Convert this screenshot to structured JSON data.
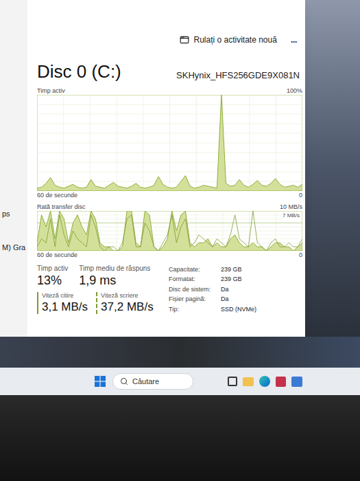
{
  "sidebar": {
    "items": [
      {
        "label": "ps"
      },
      {
        "label": "M) Gra"
      }
    ]
  },
  "toolbar": {
    "run_task": "Rulați o activitate nouă",
    "more": "..."
  },
  "disk": {
    "title": "Disc 0 (C:)",
    "model": "SKHynix_HFS256GDE9X081N"
  },
  "charts": [
    {
      "title": "Timp activ",
      "max_label": "100%",
      "x_label": "60 de secunde",
      "min_label": "0",
      "max_value": 100,
      "series": [
        {
          "name": "active",
          "kind": "area",
          "values": [
            3,
            4,
            8,
            14,
            6,
            4,
            3,
            5,
            7,
            4,
            3,
            4,
            12,
            5,
            4,
            3,
            6,
            9,
            5,
            4,
            3,
            5,
            8,
            4,
            3,
            4,
            6,
            15,
            7,
            4,
            3,
            4,
            10,
            16,
            5,
            3,
            4,
            6,
            5,
            4,
            3,
            100,
            8,
            5,
            6,
            12,
            6,
            4,
            7,
            11,
            6,
            5,
            8,
            13,
            7,
            4,
            5,
            6,
            4,
            7
          ]
        }
      ]
    },
    {
      "title": "Rată transfer disc",
      "max_label": "10 MB/s",
      "marker_label": "7 MB/s",
      "marker_value": 7,
      "x_label": "60 de secunde",
      "min_label": "0",
      "max_value": 10,
      "series": [
        {
          "name": "write",
          "kind": "area",
          "values": [
            2,
            9,
            6,
            10,
            3,
            10,
            8,
            2,
            7,
            9,
            6,
            4,
            10,
            8,
            2,
            1,
            1,
            0,
            0,
            1,
            10,
            10,
            2,
            1,
            10,
            9,
            1,
            0,
            1,
            3,
            10,
            5,
            9,
            10,
            2,
            1,
            2,
            2,
            3,
            1,
            2,
            1,
            1,
            3,
            4,
            2,
            1,
            1,
            2,
            1,
            1,
            0,
            1,
            2,
            2,
            1,
            1,
            0,
            1,
            2
          ]
        },
        {
          "name": "read",
          "kind": "line",
          "values": [
            1,
            3,
            2,
            8,
            1,
            9,
            4,
            1,
            5,
            3,
            2,
            1,
            9,
            6,
            1,
            0,
            1,
            1,
            0,
            2,
            8,
            9,
            1,
            1,
            7,
            5,
            1,
            0,
            2,
            4,
            9,
            2,
            6,
            8,
            1,
            2,
            4,
            3,
            2,
            1,
            3,
            2,
            1,
            4,
            9,
            3,
            2,
            1,
            10,
            2,
            1,
            0,
            2,
            3,
            1,
            1,
            2,
            1,
            1,
            3
          ]
        }
      ]
    }
  ],
  "stats": [
    {
      "label": "Timp activ",
      "value": "13%"
    },
    {
      "label": "Timp mediu de răspuns",
      "value": "1,9 ms"
    }
  ],
  "speeds": [
    {
      "label": "Viteză citire",
      "value": "3,1 MB/s",
      "kind": "solid"
    },
    {
      "label": "Viteză scriere",
      "value": "37,2 MB/s",
      "kind": "dashed"
    }
  ],
  "properties": [
    {
      "label": "Capacitate:",
      "value": "239 GB"
    },
    {
      "label": "Formatat:",
      "value": "239 GB"
    },
    {
      "label": "Disc de sistem:",
      "value": "Da"
    },
    {
      "label": "Fișier pagină:",
      "value": "Da"
    },
    {
      "label": "Tip:",
      "value": "SSD (NVMe)"
    }
  ],
  "taskbar": {
    "search": "Căutare"
  }
}
